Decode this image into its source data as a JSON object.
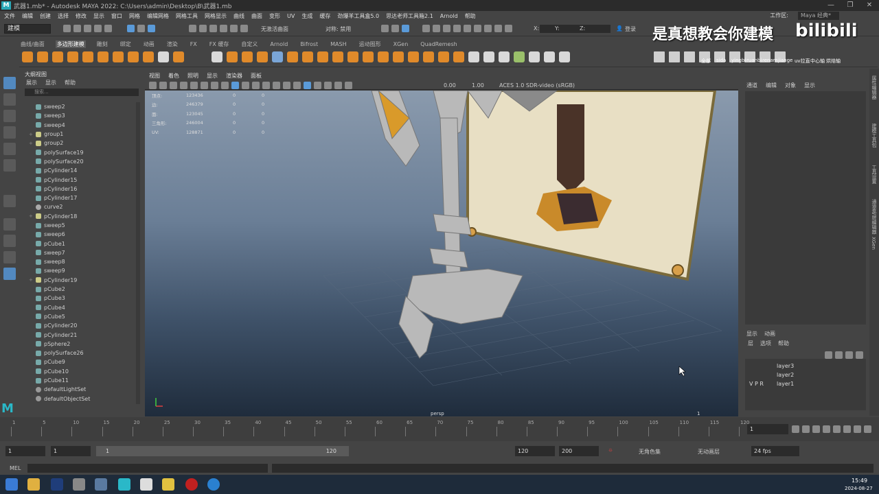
{
  "titlebar": {
    "title": "武器1.mb* - Autodesk MAYA 2022: C:\\Users\\admin\\Desktop\\B\\武器1.mb",
    "logo": "M"
  },
  "menubar": {
    "items": [
      "文件",
      "编辑",
      "创建",
      "选择",
      "修改",
      "显示",
      "窗口",
      "网格",
      "编辑网格",
      "网格工具",
      "网格显示",
      "曲线",
      "曲面",
      "变形",
      "UV",
      "生成",
      "缓存",
      "劲爆羊工具盒5.0",
      "思达老师工具箱2.1",
      "Arnold",
      "帮助"
    ],
    "workspace_label": "工作区:",
    "workspace_value": "Maya 经典*"
  },
  "statusline": {
    "mode": "建模",
    "symmetry_label": "对称: 禁用",
    "live_surface": "无激活曲面",
    "login": "登录",
    "x_label": "X:",
    "y_label": "Y:",
    "z_label": "Z:"
  },
  "shelf": {
    "tabs": [
      "曲线/曲面",
      "多边形建模",
      "雕刻",
      "绑定",
      "动画",
      "渲染",
      "FX",
      "FX 缓存",
      "自定义",
      "Arnold",
      "Bifrost",
      "MASH",
      "运动图形",
      "XGen",
      "QuadRemesh"
    ],
    "active_tab": "多边形建模",
    "script_labels": [
      "全部",
      "sida",
      "yingbi",
      "ruanbi",
      "renam",
      "jiange",
      "uv拉直",
      "中心轴",
      "烘焙轴"
    ]
  },
  "watermark": {
    "text": "是真想教会你建模",
    "logo": "bilibili"
  },
  "outliner": {
    "title": "大纲视图",
    "menu": [
      "展示",
      "显示",
      "帮助"
    ],
    "search_placeholder": "搜索...",
    "items": [
      {
        "label": "sweep2",
        "type": "s",
        "expand": ""
      },
      {
        "label": "sweep3",
        "type": "s",
        "expand": ""
      },
      {
        "label": "sweep4",
        "type": "s",
        "expand": ""
      },
      {
        "label": "group1",
        "type": "g",
        "expand": "+"
      },
      {
        "label": "group2",
        "type": "g",
        "expand": "+"
      },
      {
        "label": "polySurface19",
        "type": "s",
        "expand": ""
      },
      {
        "label": "polySurface20",
        "type": "s",
        "expand": ""
      },
      {
        "label": "pCylinder14",
        "type": "s",
        "expand": ""
      },
      {
        "label": "pCylinder15",
        "type": "s",
        "expand": ""
      },
      {
        "label": "pCylinder16",
        "type": "s",
        "expand": ""
      },
      {
        "label": "pCylinder17",
        "type": "s",
        "expand": ""
      },
      {
        "label": "curve2",
        "type": "c",
        "expand": ""
      },
      {
        "label": "pCylinder18",
        "type": "g",
        "expand": "+"
      },
      {
        "label": "sweep5",
        "type": "s",
        "expand": ""
      },
      {
        "label": "sweep6",
        "type": "s",
        "expand": ""
      },
      {
        "label": "pCube1",
        "type": "s",
        "expand": ""
      },
      {
        "label": "sweep7",
        "type": "s",
        "expand": ""
      },
      {
        "label": "sweep8",
        "type": "s",
        "expand": ""
      },
      {
        "label": "sweep9",
        "type": "s",
        "expand": ""
      },
      {
        "label": "pCylinder19",
        "type": "g",
        "expand": "+"
      },
      {
        "label": "pCube2",
        "type": "s",
        "expand": ""
      },
      {
        "label": "pCube3",
        "type": "s",
        "expand": ""
      },
      {
        "label": "pCube4",
        "type": "s",
        "expand": ""
      },
      {
        "label": "pCube5",
        "type": "s",
        "expand": ""
      },
      {
        "label": "pCylinder20",
        "type": "s",
        "expand": ""
      },
      {
        "label": "pCylinder21",
        "type": "s",
        "expand": ""
      },
      {
        "label": "pSphere2",
        "type": "s",
        "expand": ""
      },
      {
        "label": "polySurface26",
        "type": "s",
        "expand": ""
      },
      {
        "label": "pCube9",
        "type": "s",
        "expand": ""
      },
      {
        "label": "pCube10",
        "type": "s",
        "expand": ""
      },
      {
        "label": "pCube11",
        "type": "s",
        "expand": ""
      },
      {
        "label": "defaultLightSet",
        "type": "set",
        "expand": ""
      },
      {
        "label": "defaultObjectSet",
        "type": "set",
        "expand": ""
      }
    ]
  },
  "viewport": {
    "menu": [
      "视图",
      "着色",
      "照明",
      "显示",
      "渲染器",
      "面板"
    ],
    "exposure": "0.00",
    "gamma": "1.00",
    "color_space": "ACES 1.0 SDR-video (sRGB)",
    "camera_label": "persp",
    "frame_label": "1",
    "hud": [
      {
        "label": "顶点:",
        "v1": "123436",
        "v2": "0",
        "v3": "0"
      },
      {
        "label": "边:",
        "v1": "246379",
        "v2": "0",
        "v3": "0"
      },
      {
        "label": "面:",
        "v1": "123045",
        "v2": "0",
        "v3": "0"
      },
      {
        "label": "三角形:",
        "v1": "246004",
        "v2": "0",
        "v3": "0"
      },
      {
        "label": "UV:",
        "v1": "128871",
        "v2": "0",
        "v3": "0"
      }
    ]
  },
  "channelbox": {
    "menu": [
      "通道",
      "编辑",
      "对象",
      "显示"
    ]
  },
  "layers": {
    "tabs": [
      "显示",
      "动画"
    ],
    "menu": [
      "层",
      "选项",
      "帮助"
    ],
    "rows": [
      {
        "vpr": "",
        "name": "layer3"
      },
      {
        "vpr": "",
        "name": "layer2"
      },
      {
        "vpr": "V P R",
        "name": "layer1"
      }
    ]
  },
  "sidetabs": [
    "属性编辑器",
    "建模工具包",
    "工具设置",
    "通道盒/层编辑器",
    "XGen"
  ],
  "timeline": {
    "ticks": [
      "1",
      "5",
      "10",
      "15",
      "20",
      "25",
      "30",
      "35",
      "40",
      "45",
      "50",
      "55",
      "60",
      "65",
      "70",
      "75",
      "80",
      "85",
      "90",
      "95",
      "100",
      "105",
      "110",
      "115",
      "120"
    ],
    "current": "1"
  },
  "range": {
    "start": "1",
    "start_inner": "1",
    "slider_start": "1",
    "slider_end": "120",
    "end_inner": "120",
    "end": "200",
    "character_set": "无角色集",
    "anim_layer": "无动画层",
    "fps": "24 fps"
  },
  "mel": {
    "label": "MEL"
  },
  "taskbar": {
    "time": "15:49",
    "date": "2024-08-27"
  }
}
